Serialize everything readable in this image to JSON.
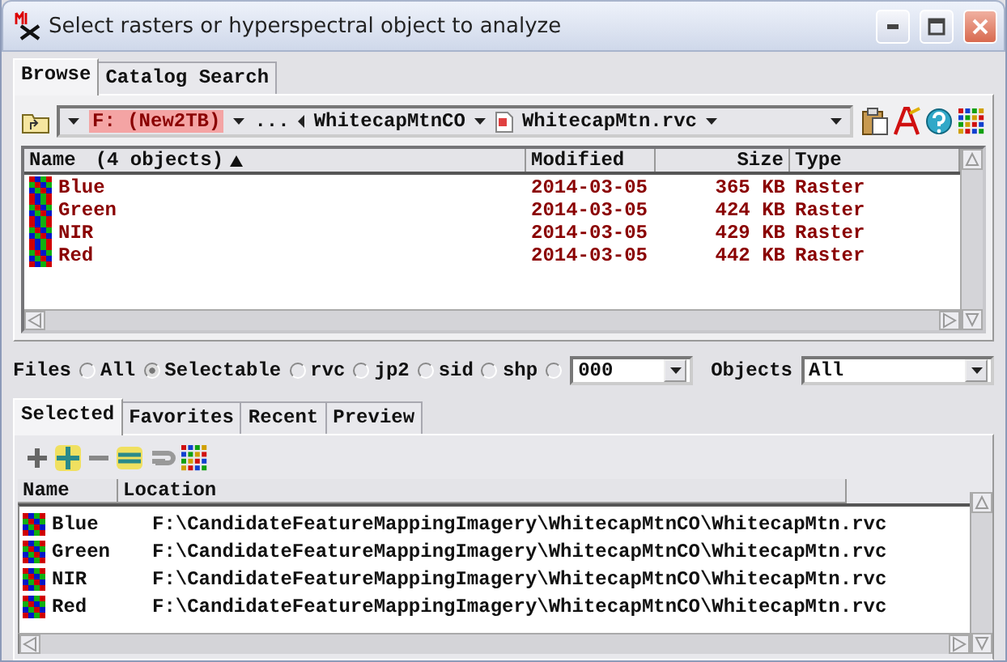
{
  "window": {
    "title": "Select rasters or hyperspectral object to analyze"
  },
  "top_tabs": [
    {
      "label": "Browse",
      "selected": true
    },
    {
      "label": "Catalog Search",
      "selected": false
    }
  ],
  "path_bar": {
    "drive": "F: (New2TB)",
    "ellipsis": "...",
    "folder": "WhitecapMtnCO",
    "file": "WhitecapMtn.rvc"
  },
  "browse_list": {
    "columns": [
      "Name",
      "Modified",
      "Size",
      "Type"
    ],
    "object_count": "(4 objects)",
    "rows": [
      {
        "name": "Blue",
        "modified": "2014-03-05",
        "size": "365 KB",
        "type": "Raster"
      },
      {
        "name": "Green",
        "modified": "2014-03-05",
        "size": "424 KB",
        "type": "Raster"
      },
      {
        "name": "NIR",
        "modified": "2014-03-05",
        "size": "429 KB",
        "type": "Raster"
      },
      {
        "name": "Red",
        "modified": "2014-03-05",
        "size": "442 KB",
        "type": "Raster"
      }
    ]
  },
  "files_filter": {
    "label": "Files",
    "options": [
      {
        "kind": "radio",
        "label": "All",
        "selected": false
      },
      {
        "kind": "radio",
        "label": "Selectable",
        "selected": true
      },
      {
        "kind": "radio",
        "label": "rvc",
        "selected": false
      },
      {
        "kind": "radio",
        "label": "jp2",
        "selected": false
      },
      {
        "kind": "radio",
        "label": "sid",
        "selected": false
      },
      {
        "kind": "radio",
        "label": "shp",
        "selected": false
      },
      {
        "kind": "combo",
        "value": "000",
        "selected": false
      }
    ],
    "objects_label": "Objects",
    "objects_value": "All"
  },
  "bottom_tabs": [
    {
      "label": "Selected",
      "selected": true
    },
    {
      "label": "Favorites",
      "selected": false
    },
    {
      "label": "Recent",
      "selected": false
    },
    {
      "label": "Preview",
      "selected": false
    }
  ],
  "selected_list": {
    "columns": [
      "Name",
      "Location"
    ],
    "rows": [
      {
        "name": "Blue",
        "location": "F:\\CandidateFeatureMappingImagery\\WhitecapMtnCO\\WhitecapMtn.rvc"
      },
      {
        "name": "Green",
        "location": "F:\\CandidateFeatureMappingImagery\\WhitecapMtnCO\\WhitecapMtn.rvc"
      },
      {
        "name": "NIR",
        "location": "F:\\CandidateFeatureMappingImagery\\WhitecapMtnCO\\WhitecapMtn.rvc"
      },
      {
        "name": "Red",
        "location": "F:\\CandidateFeatureMappingImagery\\WhitecapMtnCO\\WhitecapMtn.rvc"
      }
    ]
  }
}
